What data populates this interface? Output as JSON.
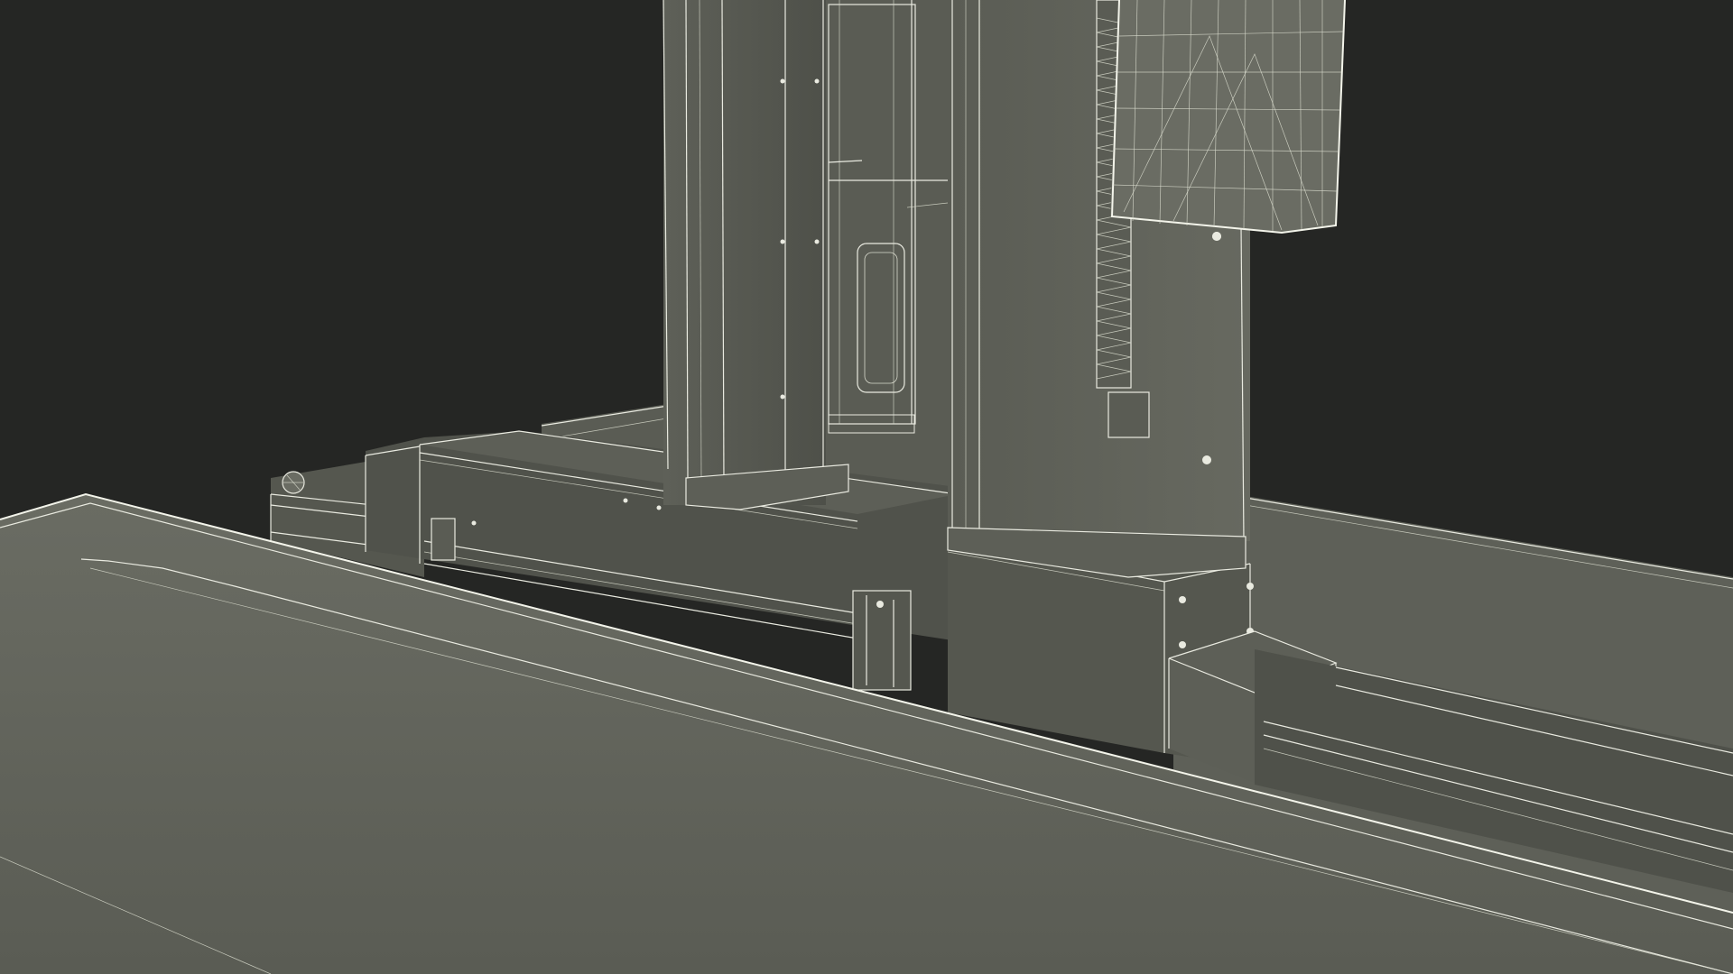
{
  "scene": {
    "subject": "wireframe-3d-render",
    "colors": {
      "background": "#252624",
      "surface_dark": "#4f514a",
      "surface_mid": "#5c5e56",
      "surface_light": "#6a6c63",
      "wire": "#e9eae0"
    }
  }
}
